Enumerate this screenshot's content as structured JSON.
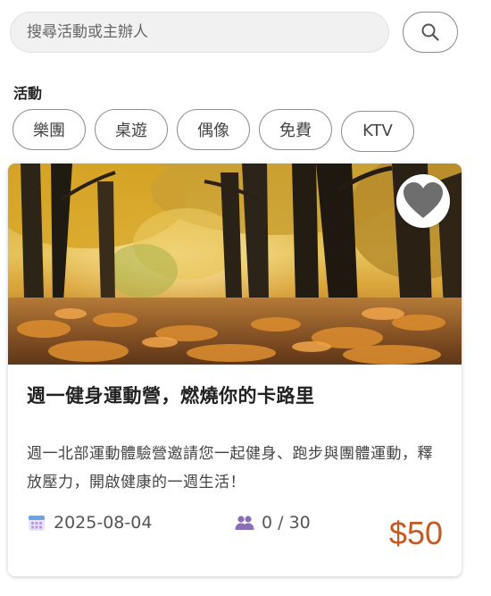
{
  "search": {
    "placeholder": "搜尋活動或主辦人",
    "icon": "search-icon"
  },
  "filters": {
    "label": "活動",
    "tags": [
      "樂團",
      "桌遊",
      "偶像",
      "免費",
      "KTV"
    ]
  },
  "event": {
    "title": "週一健身運動營，燃燒你的卡路里",
    "description": "週一北部運動體驗營邀請您一起健身、跑步與團體運動，釋放壓力，開啟健康的一週生活！",
    "date": "2025-08-04",
    "participants": "0 / 30",
    "price": "$50",
    "favorite_icon": "heart-icon",
    "date_icon": "calendar-icon",
    "people_icon": "people-icon"
  },
  "colors": {
    "price": "#c55a22",
    "people_icon": "#8a6fb8",
    "heart": "#6e6e6e"
  }
}
